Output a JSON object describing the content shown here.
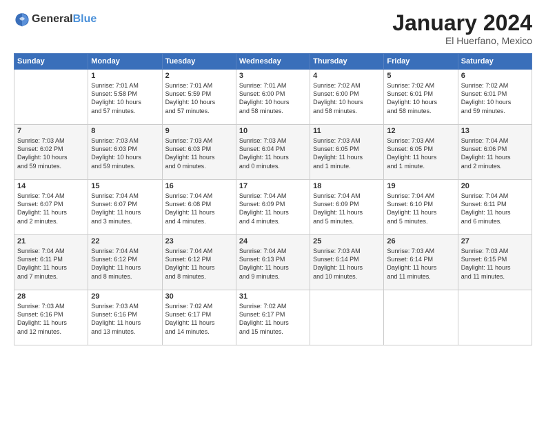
{
  "logo": {
    "general": "General",
    "blue": "Blue"
  },
  "title": "January 2024",
  "location": "El Huerfano, Mexico",
  "weekdays": [
    "Sunday",
    "Monday",
    "Tuesday",
    "Wednesday",
    "Thursday",
    "Friday",
    "Saturday"
  ],
  "weeks": [
    [
      {
        "day": "",
        "info": ""
      },
      {
        "day": "1",
        "info": "Sunrise: 7:01 AM\nSunset: 5:58 PM\nDaylight: 10 hours\nand 57 minutes."
      },
      {
        "day": "2",
        "info": "Sunrise: 7:01 AM\nSunset: 5:59 PM\nDaylight: 10 hours\nand 57 minutes."
      },
      {
        "day": "3",
        "info": "Sunrise: 7:01 AM\nSunset: 6:00 PM\nDaylight: 10 hours\nand 58 minutes."
      },
      {
        "day": "4",
        "info": "Sunrise: 7:02 AM\nSunset: 6:00 PM\nDaylight: 10 hours\nand 58 minutes."
      },
      {
        "day": "5",
        "info": "Sunrise: 7:02 AM\nSunset: 6:01 PM\nDaylight: 10 hours\nand 58 minutes."
      },
      {
        "day": "6",
        "info": "Sunrise: 7:02 AM\nSunset: 6:01 PM\nDaylight: 10 hours\nand 59 minutes."
      }
    ],
    [
      {
        "day": "7",
        "info": "Sunrise: 7:03 AM\nSunset: 6:02 PM\nDaylight: 10 hours\nand 59 minutes."
      },
      {
        "day": "8",
        "info": "Sunrise: 7:03 AM\nSunset: 6:03 PM\nDaylight: 10 hours\nand 59 minutes."
      },
      {
        "day": "9",
        "info": "Sunrise: 7:03 AM\nSunset: 6:03 PM\nDaylight: 11 hours\nand 0 minutes."
      },
      {
        "day": "10",
        "info": "Sunrise: 7:03 AM\nSunset: 6:04 PM\nDaylight: 11 hours\nand 0 minutes."
      },
      {
        "day": "11",
        "info": "Sunrise: 7:03 AM\nSunset: 6:05 PM\nDaylight: 11 hours\nand 1 minute."
      },
      {
        "day": "12",
        "info": "Sunrise: 7:03 AM\nSunset: 6:05 PM\nDaylight: 11 hours\nand 1 minute."
      },
      {
        "day": "13",
        "info": "Sunrise: 7:04 AM\nSunset: 6:06 PM\nDaylight: 11 hours\nand 2 minutes."
      }
    ],
    [
      {
        "day": "14",
        "info": "Sunrise: 7:04 AM\nSunset: 6:07 PM\nDaylight: 11 hours\nand 2 minutes."
      },
      {
        "day": "15",
        "info": "Sunrise: 7:04 AM\nSunset: 6:07 PM\nDaylight: 11 hours\nand 3 minutes."
      },
      {
        "day": "16",
        "info": "Sunrise: 7:04 AM\nSunset: 6:08 PM\nDaylight: 11 hours\nand 4 minutes."
      },
      {
        "day": "17",
        "info": "Sunrise: 7:04 AM\nSunset: 6:09 PM\nDaylight: 11 hours\nand 4 minutes."
      },
      {
        "day": "18",
        "info": "Sunrise: 7:04 AM\nSunset: 6:09 PM\nDaylight: 11 hours\nand 5 minutes."
      },
      {
        "day": "19",
        "info": "Sunrise: 7:04 AM\nSunset: 6:10 PM\nDaylight: 11 hours\nand 5 minutes."
      },
      {
        "day": "20",
        "info": "Sunrise: 7:04 AM\nSunset: 6:11 PM\nDaylight: 11 hours\nand 6 minutes."
      }
    ],
    [
      {
        "day": "21",
        "info": "Sunrise: 7:04 AM\nSunset: 6:11 PM\nDaylight: 11 hours\nand 7 minutes."
      },
      {
        "day": "22",
        "info": "Sunrise: 7:04 AM\nSunset: 6:12 PM\nDaylight: 11 hours\nand 8 minutes."
      },
      {
        "day": "23",
        "info": "Sunrise: 7:04 AM\nSunset: 6:12 PM\nDaylight: 11 hours\nand 8 minutes."
      },
      {
        "day": "24",
        "info": "Sunrise: 7:04 AM\nSunset: 6:13 PM\nDaylight: 11 hours\nand 9 minutes."
      },
      {
        "day": "25",
        "info": "Sunrise: 7:03 AM\nSunset: 6:14 PM\nDaylight: 11 hours\nand 10 minutes."
      },
      {
        "day": "26",
        "info": "Sunrise: 7:03 AM\nSunset: 6:14 PM\nDaylight: 11 hours\nand 11 minutes."
      },
      {
        "day": "27",
        "info": "Sunrise: 7:03 AM\nSunset: 6:15 PM\nDaylight: 11 hours\nand 11 minutes."
      }
    ],
    [
      {
        "day": "28",
        "info": "Sunrise: 7:03 AM\nSunset: 6:16 PM\nDaylight: 11 hours\nand 12 minutes."
      },
      {
        "day": "29",
        "info": "Sunrise: 7:03 AM\nSunset: 6:16 PM\nDaylight: 11 hours\nand 13 minutes."
      },
      {
        "day": "30",
        "info": "Sunrise: 7:02 AM\nSunset: 6:17 PM\nDaylight: 11 hours\nand 14 minutes."
      },
      {
        "day": "31",
        "info": "Sunrise: 7:02 AM\nSunset: 6:17 PM\nDaylight: 11 hours\nand 15 minutes."
      },
      {
        "day": "",
        "info": ""
      },
      {
        "day": "",
        "info": ""
      },
      {
        "day": "",
        "info": ""
      }
    ]
  ]
}
